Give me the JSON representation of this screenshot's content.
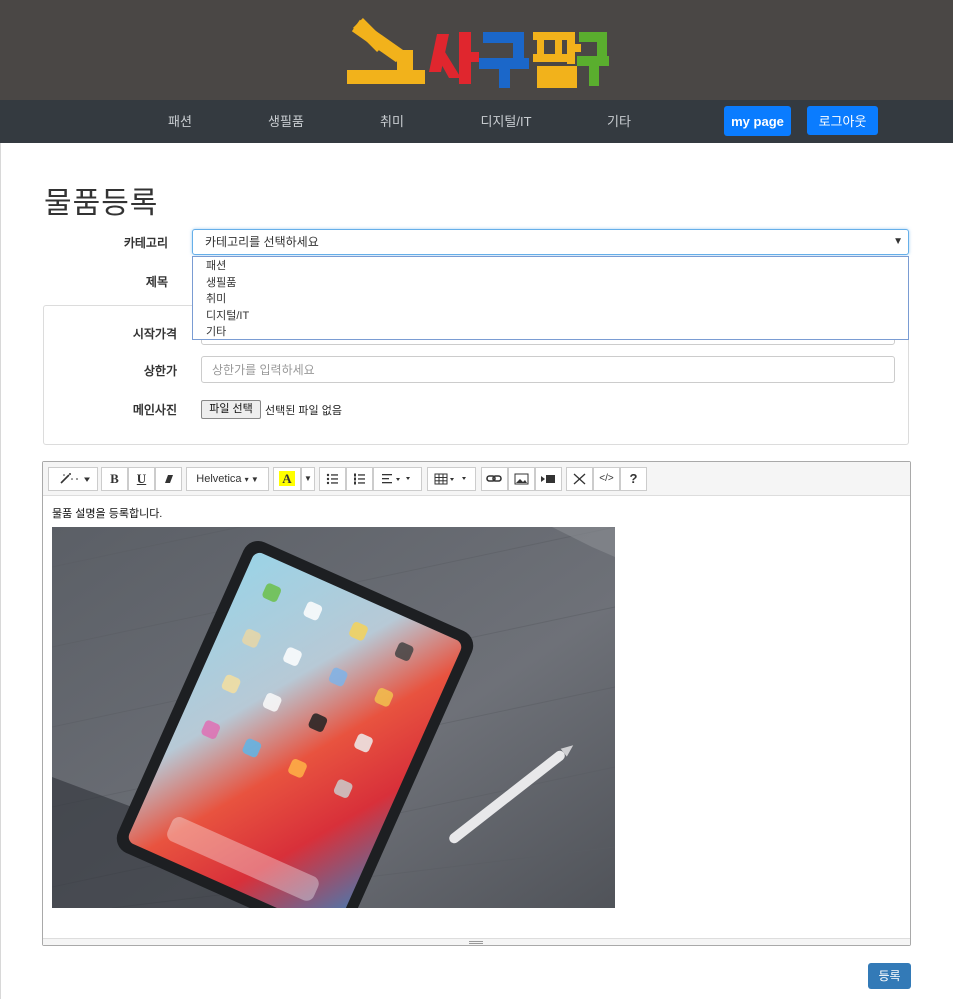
{
  "header": {
    "logo_text": "사구팔구",
    "nav_items": [
      "패션",
      "생필품",
      "취미",
      "디지털/IT",
      "기타"
    ],
    "mypage_label": "my page",
    "logout_label": "로그아웃"
  },
  "form": {
    "title": "물품등록",
    "category_label": "카테고리",
    "category_selected": "카테고리를 선택하세요",
    "category_options": [
      "패션",
      "생필품",
      "취미",
      "디지털/IT",
      "기타"
    ],
    "title_label": "제목",
    "start_price_label": "시작가격",
    "max_price_label": "상한가",
    "max_price_placeholder": "상한가를 입력하세요",
    "main_photo_label": "메인사진",
    "file_button_label": "파일 선택",
    "file_status": "선택된 파일 없음"
  },
  "editor": {
    "font_name": "Helvetica",
    "content_text": "물품 설명을 등록합니다.",
    "bold_label": "B",
    "underline_label": "U",
    "highlight_label": "A",
    "code_label": "</>",
    "help_label": "?"
  },
  "submit_label": "등록",
  "colors": {
    "header_bg": "#4a4745",
    "navbar_bg": "#343a40",
    "primary": "#0a7cff",
    "submit": "#337ab7"
  }
}
